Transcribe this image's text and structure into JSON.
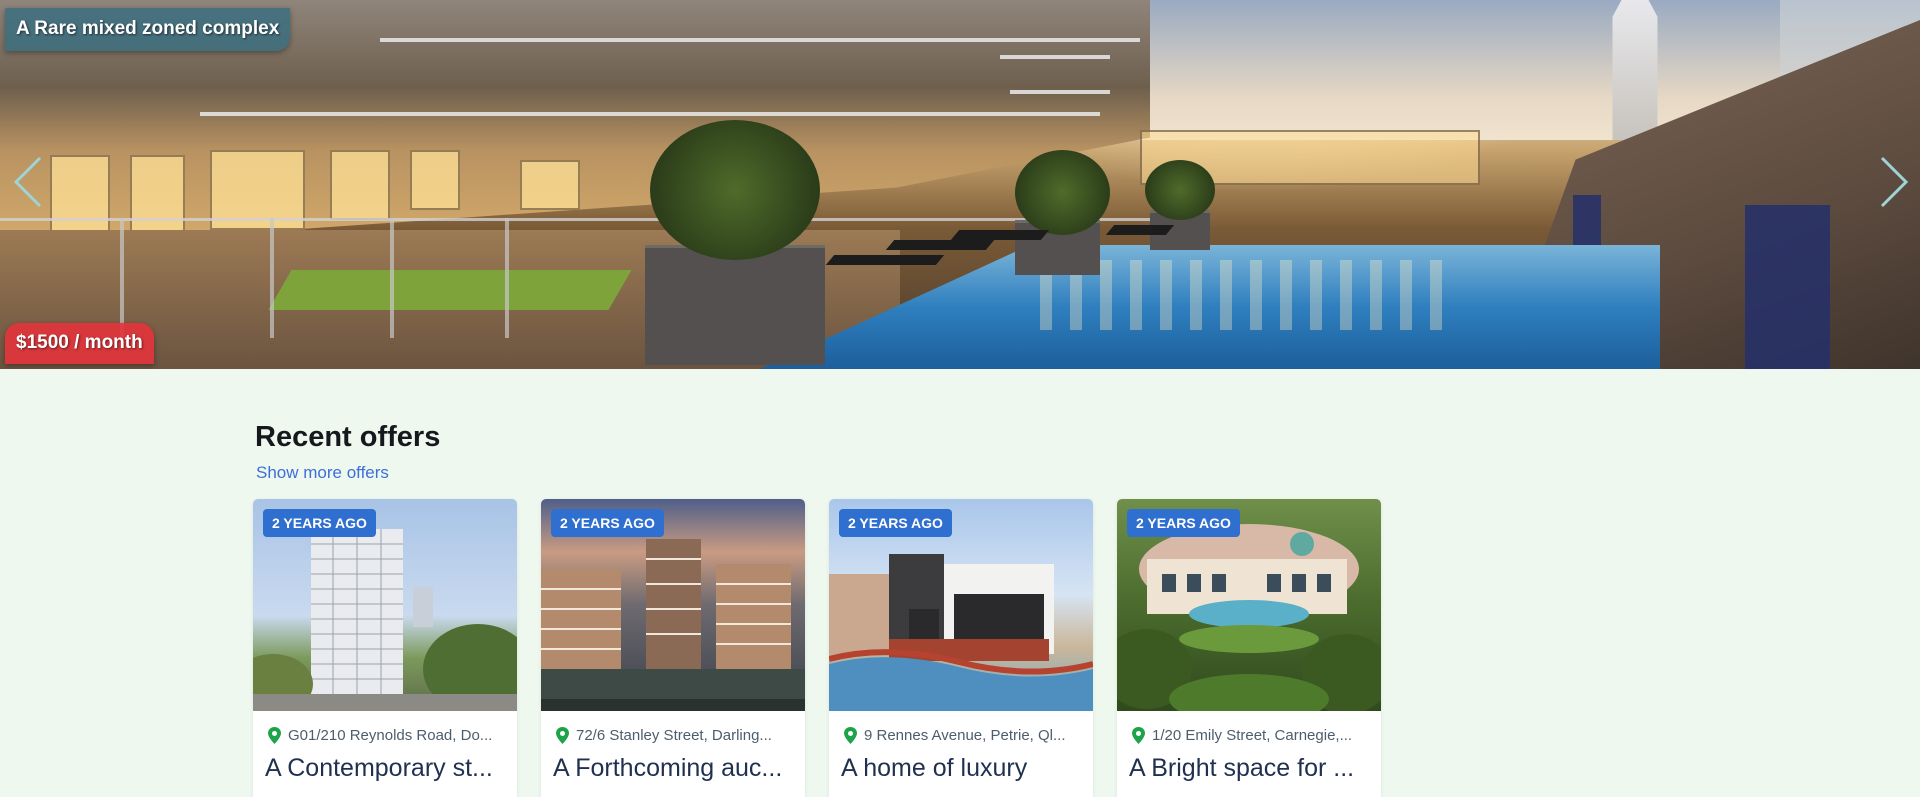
{
  "hero": {
    "title": "A Rare mixed zoned complex",
    "price": "$1500 / month",
    "prev_icon": "chevron-left-icon",
    "next_icon": "chevron-right-icon"
  },
  "recent": {
    "heading": "Recent offers",
    "more_link": "Show more offers",
    "cards": [
      {
        "time": "2 years ago",
        "address": "G01/210 Reynolds Road, Do...",
        "title": "A Contemporary st..."
      },
      {
        "time": "2 years ago",
        "address": "72/6 Stanley Street, Darling...",
        "title": "A Forthcoming auc..."
      },
      {
        "time": "2 years ago",
        "address": "9 Rennes Avenue, Petrie, Ql...",
        "title": "A home of luxury"
      },
      {
        "time": "2 years ago",
        "address": "1/20 Emily Street, Carnegie,...",
        "title": "A Bright space for ..."
      }
    ]
  },
  "colors": {
    "page_background": "#eef8ee",
    "title_badge": "#3c6e80",
    "price_badge": "#e1343c",
    "time_badge": "#2f6fcf",
    "link": "#3d6fd9",
    "pin": "#1fa34a"
  }
}
